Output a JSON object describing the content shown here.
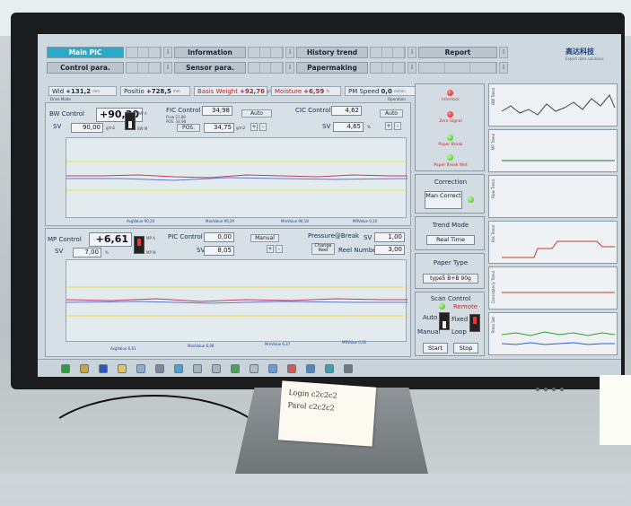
{
  "nav": {
    "top": [
      "Main PIC",
      "Information",
      "History trend",
      "Report"
    ],
    "bottom": [
      "Control para.",
      "Sensor para.",
      "Papermaking"
    ]
  },
  "brand": {
    "name": "高达科技",
    "sub": "Expert data solutions"
  },
  "status": {
    "wid_label": "Wid",
    "wid_value": "+131,2",
    "wid_unit": "mm",
    "pos_label": "Positio",
    "pos_value": "+728,5",
    "pos_unit": "mm",
    "bw_label": "Basis Weight",
    "bw_value": "+92,76",
    "bw_unit": "g/m2",
    "moist_label": "Moisture",
    "moist_value": "+6,59",
    "moist_unit": "%",
    "speed_label": "PM Speed",
    "speed_value": "0,0",
    "speed_unit": "m/min",
    "mode": "Drive Mode",
    "operation": "Operation"
  },
  "bw": {
    "title": "BW Control",
    "value": "+90,20",
    "sv_label": "SV",
    "sv": "90,00",
    "unit": "g/m2",
    "m_a": "BW A",
    "m_m": "BW M",
    "fic_title": "FIC Control",
    "fic_value": "34,98",
    "fic_sv": "34,75",
    "fic_flow": "Flow 21,88",
    "fic_pos": "POS. 34,98",
    "fic_pos_btn": "POS.",
    "fic_unit": "g/m2",
    "fic_mode": "Auto",
    "cic_title": "CIC Control",
    "cic_value": "4,62",
    "cic_sv": "4,65",
    "cic_unit": "%",
    "cic_mode": "Auto"
  },
  "chart1": {
    "xticks": [
      "400",
      "600",
      "800",
      "1000",
      "1200",
      "1400",
      "1600",
      "1800",
      "2000",
      "2200",
      "2400",
      "2600",
      "2800"
    ],
    "avg": "AvgValue 90,20",
    "max": "MaxValue 90,29",
    "min": "MinValue 90,18",
    "mr": "MRValue 0,10"
  },
  "mp": {
    "title": "MP Control",
    "value": "+6,61",
    "sv_label": "SV",
    "sv": "7,00",
    "unit": "%",
    "m_a": "MP A",
    "m_m": "MP M",
    "pic_title": "PIC Control",
    "pic_value": "0,00",
    "pic_sv": "8,05",
    "pic_mode": "Manual",
    "pressure_label": "Pressure@Break",
    "pressure_sv_label": "SV",
    "pressure_sv": "1,00",
    "change_reel": "Change Reel",
    "reel_label": "Reel Number",
    "reel_value": "3,00"
  },
  "chart2": {
    "xticks": [
      "400",
      "600",
      "800",
      "1000",
      "1200",
      "1400",
      "1600",
      "1800",
      "2000",
      "2200",
      "2400",
      "2600",
      "2800"
    ],
    "avg": "AvgValue 6,61",
    "max": "MaxValue 6,98",
    "min": "MinValue 6,37",
    "mr": "MRValue 0,02"
  },
  "right": {
    "alarms": [
      "Interlock",
      "Zero Signal",
      "Paper Break",
      "Paper Break Wet"
    ],
    "correction_title": "Correction",
    "correction_btn": "Man Correct",
    "trend_title": "Trend Mode",
    "trend_btn": "Real Time",
    "paper_title": "Paper Type",
    "paper_value": "type5 B+B 90g",
    "scan_title": "Scan Control",
    "scan_remote": "Remote",
    "scan_auto": "Auto",
    "scan_manual": "Manual",
    "scan_fixed": "Fixed",
    "scan_loop": "Loop",
    "start": "Start",
    "stop": "Stop"
  },
  "trends": [
    "BW Trend",
    "MP Trend",
    "Flow Trend",
    "Pos Trend",
    "Consistency Trend",
    "Press Set"
  ],
  "note": {
    "line1": "Login c2c2c2",
    "line2": "Parol c2c2c2"
  },
  "colors": {
    "active_tab": "#2aa9c8",
    "alarm_red": "#d31515",
    "ok_green": "#3bb51c"
  }
}
